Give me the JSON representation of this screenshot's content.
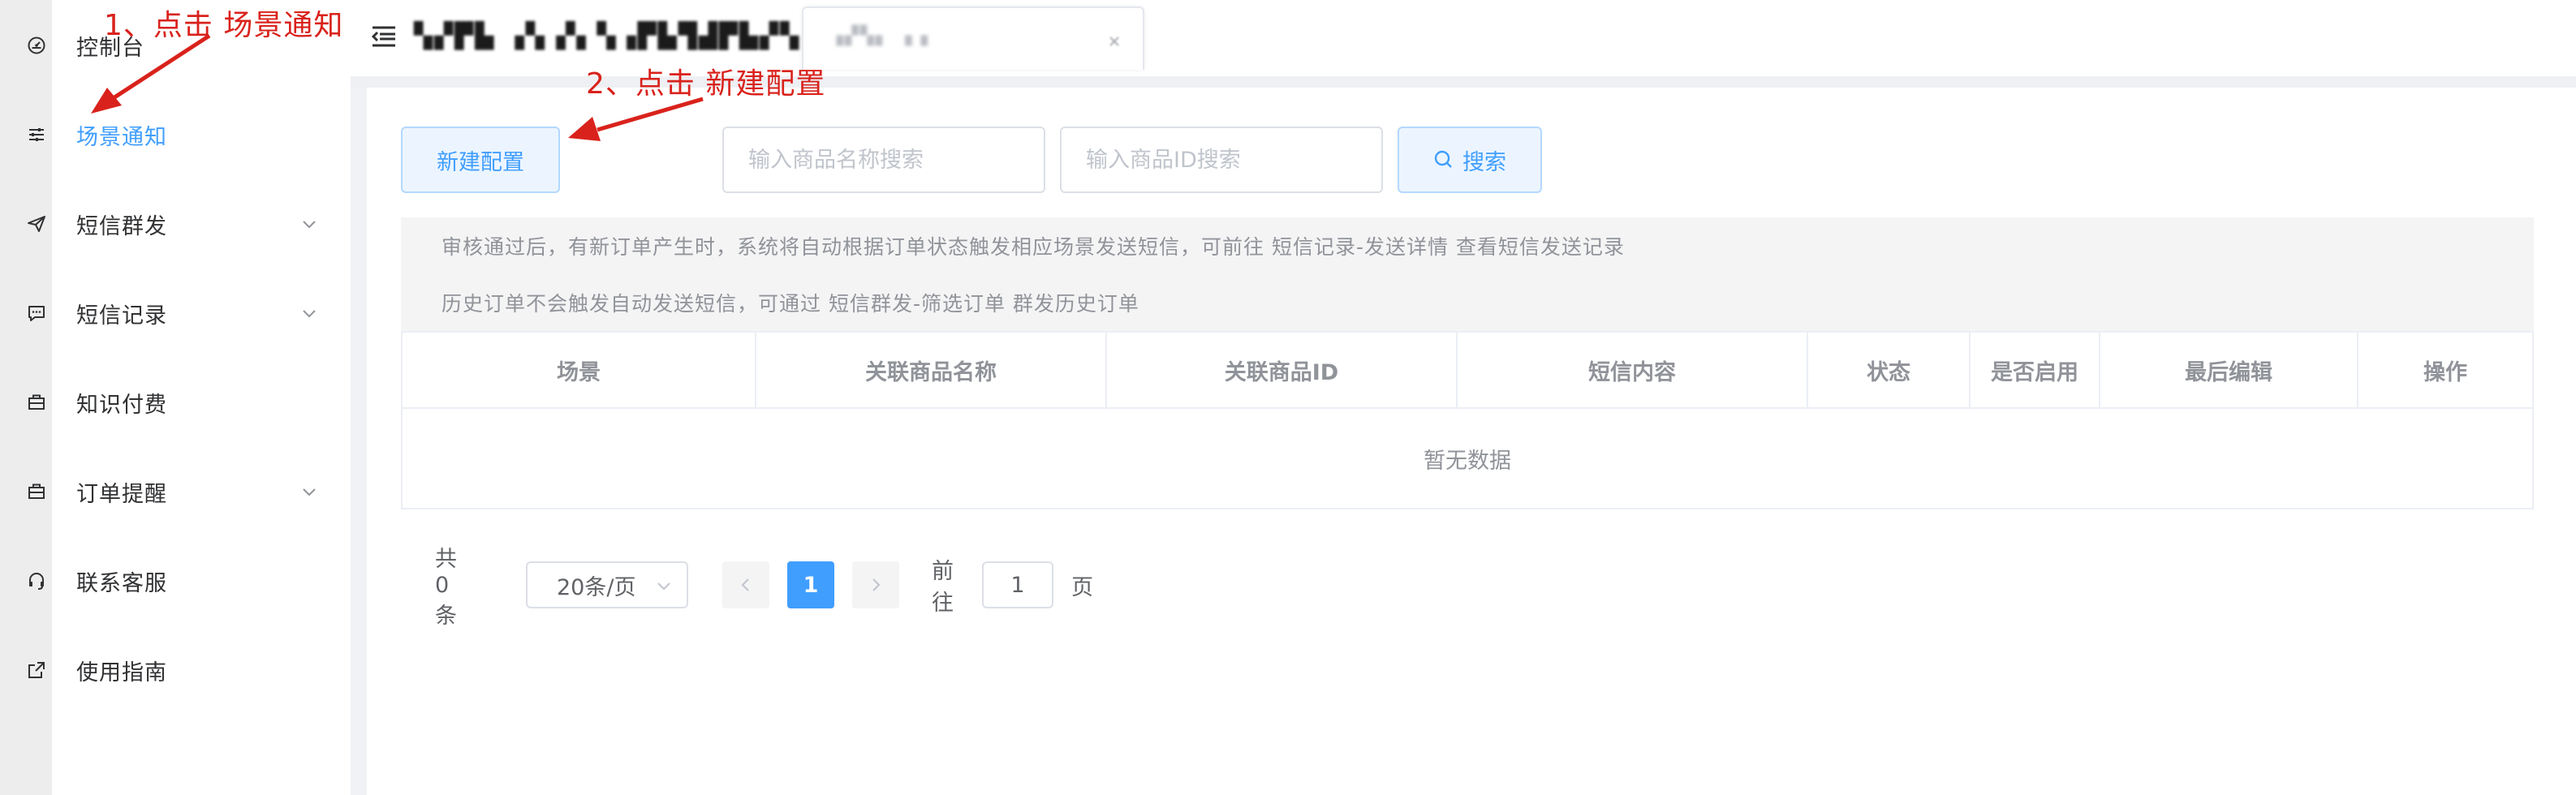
{
  "sidebar": {
    "items": [
      {
        "label": "控制台",
        "icon": "dashboard-icon"
      },
      {
        "label": "场景通知",
        "icon": "sliders-icon",
        "active": true
      },
      {
        "label": "短信群发",
        "icon": "send-icon",
        "has_submenu": true
      },
      {
        "label": "短信记录",
        "icon": "message-icon",
        "has_submenu": true
      },
      {
        "label": "知识付费",
        "icon": "briefcase-icon"
      },
      {
        "label": "订单提醒",
        "icon": "briefcase-icon",
        "has_submenu": true
      },
      {
        "label": "联系客服",
        "icon": "headset-icon"
      },
      {
        "label": "使用指南",
        "icon": "external-link-icon"
      }
    ],
    "active_color": "#409eff"
  },
  "topbar": {
    "menu_icon": "menu-fold-icon",
    "close_icon": "close-icon"
  },
  "toolbar": {
    "new_config_label": "新建配置",
    "search_name_placeholder": "输入商品名称搜索",
    "search_id_placeholder": "输入商品ID搜索",
    "search_label": "搜索",
    "search_icon": "search-icon"
  },
  "notices": [
    "审核通过后，有新订单产生时，系统将自动根据订单状态触发相应场景发送短信，可前往 短信记录-发送详情 查看短信发送记录",
    "历史订单不会触发自动发送短信，可通过 短信群发-筛选订单 群发历史订单"
  ],
  "table": {
    "columns": [
      "场景",
      "关联商品名称",
      "关联商品ID",
      "短信内容",
      "状态",
      "是否启用",
      "最后编辑",
      "操作"
    ],
    "rows": [],
    "empty_text": "暂无数据"
  },
  "pagination": {
    "total_text": "共 0 条",
    "page_size": "20条/页",
    "current_page": "1",
    "goto_label": "前往",
    "jump_value": "1",
    "page_suffix": "页"
  },
  "annotations": {
    "step1": "1、点击 场景通知",
    "step2": "2、点击 新建配置",
    "color": "#d9221c"
  }
}
